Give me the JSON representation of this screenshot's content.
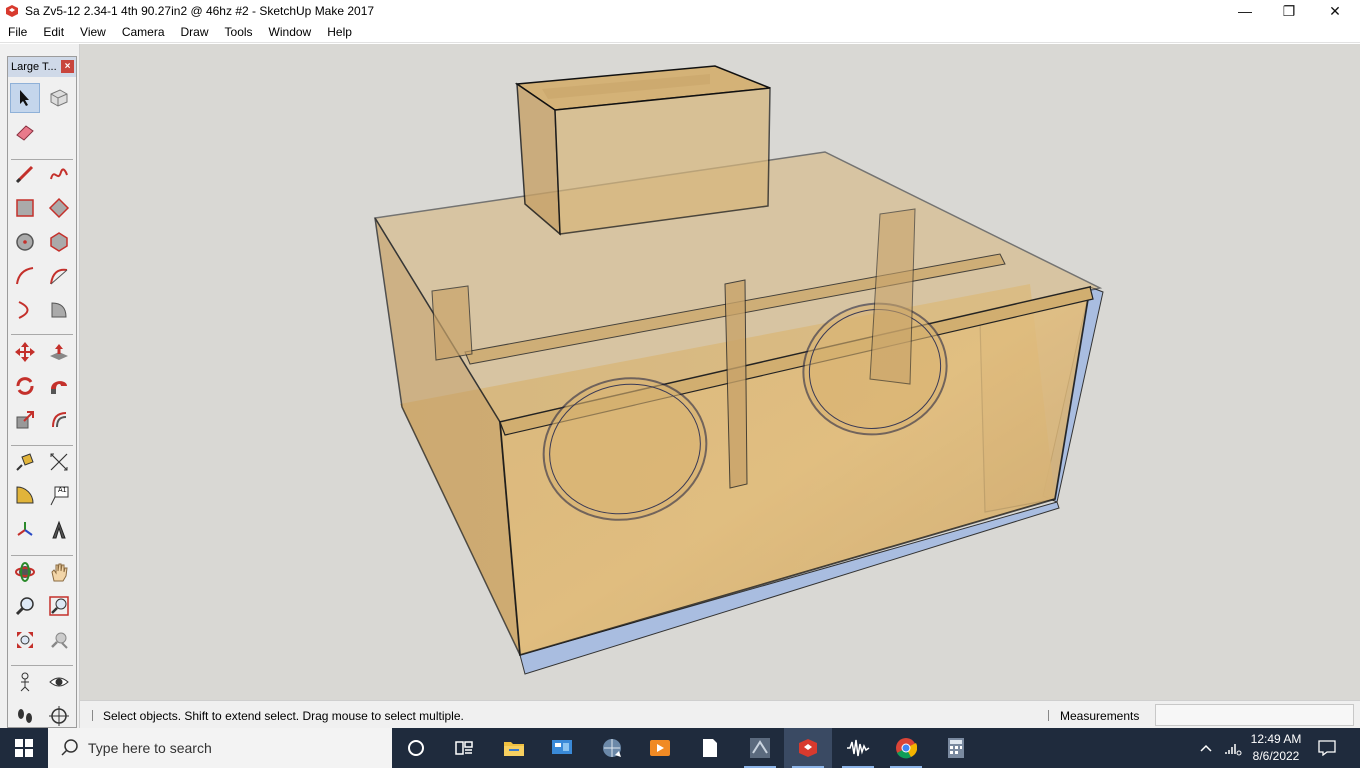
{
  "window": {
    "title": "Sa Zv5-12 2.34-1 4th 90.27in2 @ 46hz #2 - SketchUp Make 2017",
    "icon": "sketchup-icon",
    "controls": {
      "minimize": "—",
      "maximize": "❐",
      "close": "✕"
    }
  },
  "menu": {
    "items": [
      "File",
      "Edit",
      "View",
      "Camera",
      "Draw",
      "Tools",
      "Window",
      "Help"
    ]
  },
  "toolbar": {
    "title": "Large T...",
    "close": "×",
    "tools": [
      "select-tool",
      "component-tool",
      "eraser-tool",
      "line-tool",
      "freehand-tool",
      "rectangle-tool",
      "rotated-rectangle-tool",
      "circle-tool",
      "polygon-tool",
      "arc-tool",
      "two-point-arc-tool",
      "three-point-arc-tool",
      "pie-tool",
      "move-tool",
      "push-pull-tool",
      "rotate-tool",
      "follow-me-tool",
      "scale-tool",
      "offset-tool",
      "tape-measure-tool",
      "dimension-tool",
      "protractor-tool",
      "text-tool",
      "axes-tool",
      "3d-text-tool",
      "orbit-tool",
      "pan-tool",
      "zoom-tool",
      "zoom-window-tool",
      "zoom-extents-tool",
      "previous-view-tool",
      "position-camera-tool",
      "look-around-tool",
      "walk-tool",
      "section-plane-tool"
    ],
    "text_tool_label": "A1"
  },
  "status": {
    "hint": "Select objects. Shift to extend select. Drag mouse to select multiple.",
    "measurements_label": "Measurements",
    "measurements_value": ""
  },
  "taskbar": {
    "search_placeholder": "Type here to search",
    "apps": [
      "cortana-icon",
      "task-view-icon",
      "file-explorer-icon",
      "control-panel-icon",
      "network-icon",
      "media-player-icon",
      "document-icon",
      "gimp-icon",
      "sketchup-icon",
      "audio-editor-icon",
      "chrome-icon",
      "calculator-icon"
    ],
    "clock_time": "12:49 AM",
    "clock_date": "8/6/2022"
  }
}
